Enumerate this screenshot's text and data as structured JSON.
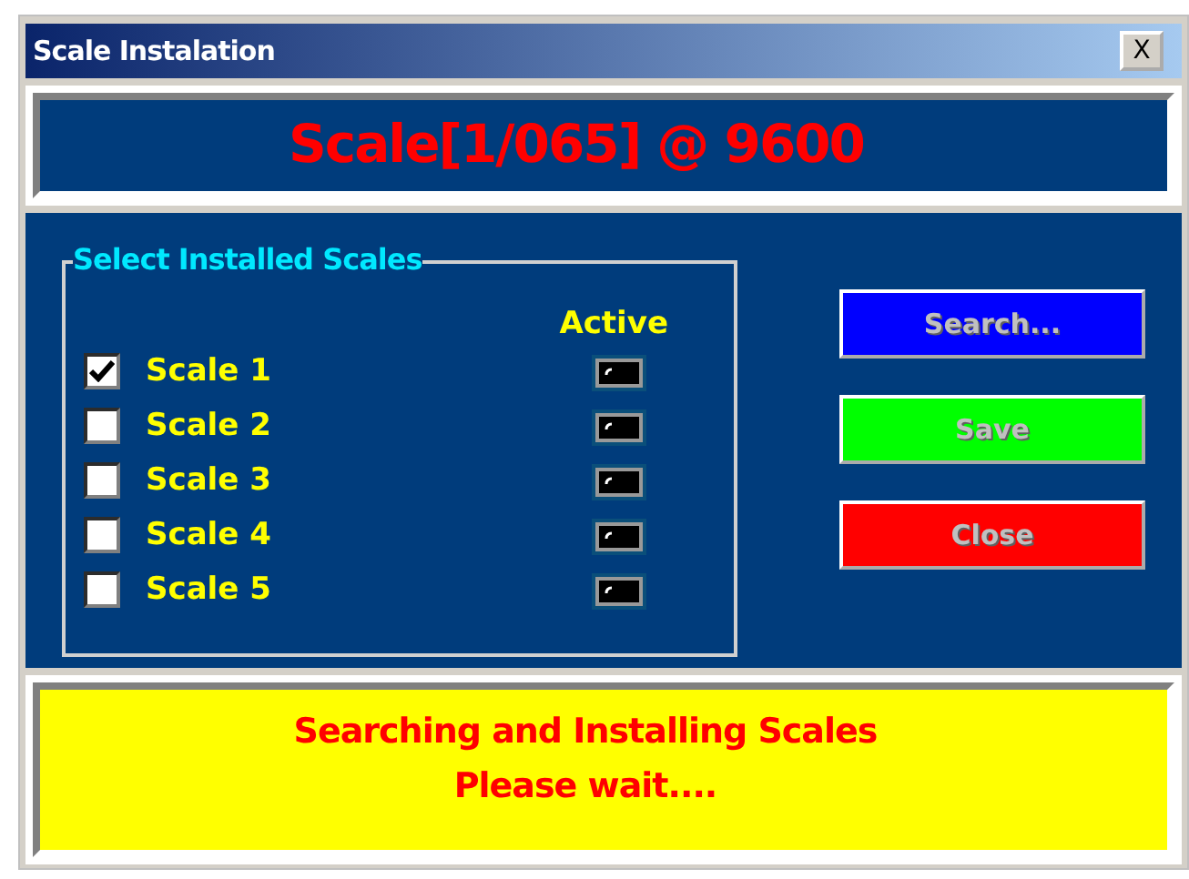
{
  "window": {
    "title": "Scale Instalation",
    "close": "X"
  },
  "header": "Scale[1/065] @ 9600",
  "group": {
    "title": "Select Installed Scales",
    "column_label": "Active",
    "scales": [
      {
        "label": "Scale 1",
        "checked": true
      },
      {
        "label": "Scale 2",
        "checked": false
      },
      {
        "label": "Scale 3",
        "checked": false
      },
      {
        "label": "Scale 4",
        "checked": false
      },
      {
        "label": "Scale 5",
        "checked": false
      }
    ]
  },
  "buttons": [
    {
      "label": "Search...",
      "color": "#0000ff",
      "disabled": true
    },
    {
      "label": "Save",
      "color": "#00ff00",
      "disabled": true
    },
    {
      "label": "Close",
      "color": "#ff0000",
      "disabled": true
    }
  ],
  "status": [
    "Searching and Installing Scales",
    "Please wait...."
  ]
}
